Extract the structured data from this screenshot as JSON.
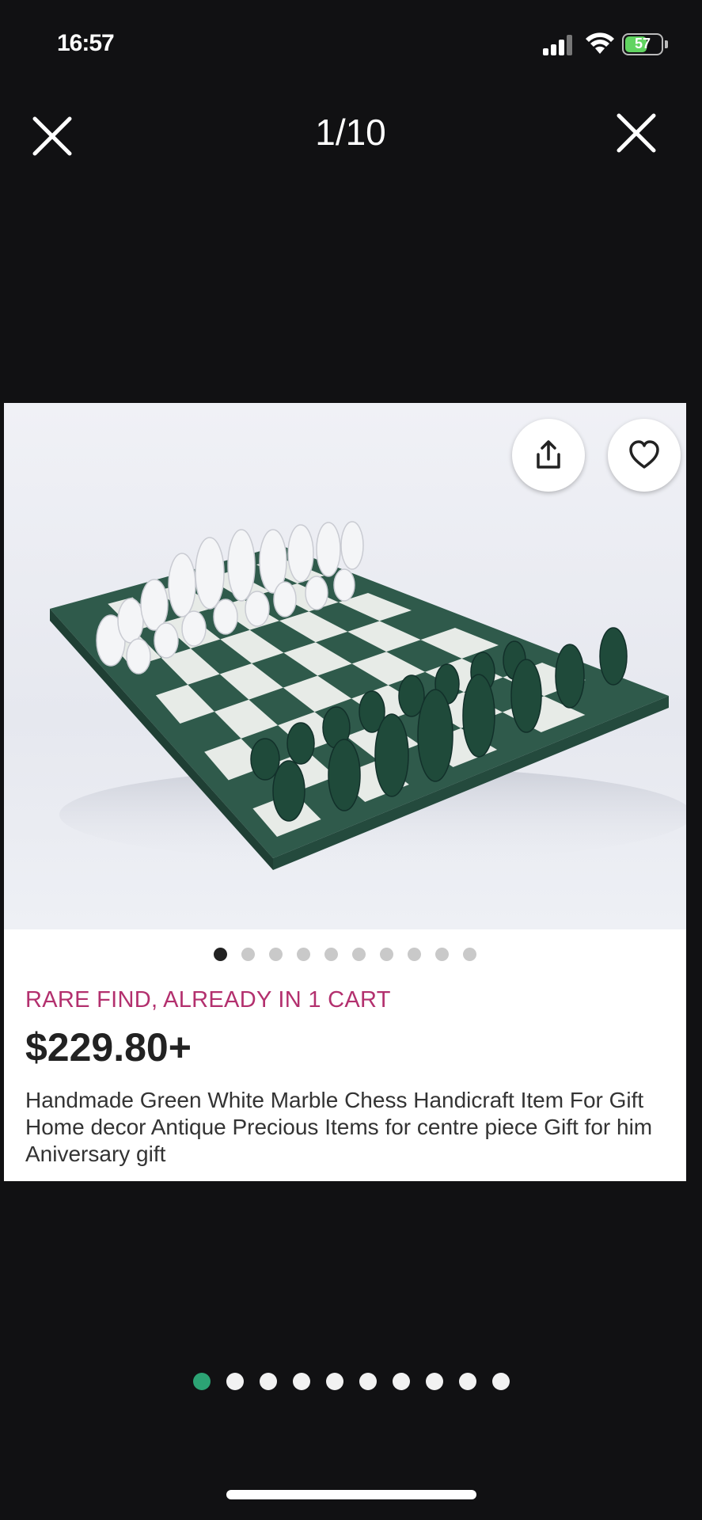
{
  "status_bar": {
    "time": "16:57",
    "battery": "57"
  },
  "header": {
    "counter": "1/10"
  },
  "listing": {
    "badge": "RARE FIND, ALREADY IN 1 CART",
    "price": "$229.80+",
    "title": "Handmade Green White Marble Chess Handicraft Item For Gift Home decor Antique Precious Items for centre piece Gift for him Aniversary gift"
  },
  "icons": {
    "close": "close-icon",
    "share": "share-icon",
    "favorite": "heart-icon"
  },
  "image_carousel": {
    "total": 10,
    "active_index": 0
  },
  "page_carousel": {
    "total": 10,
    "active_index": 0
  },
  "colors": {
    "background": "#111113",
    "badge": "#b3306e",
    "active_page_dot": "#2ca374",
    "board_dark": "#2f5a4b",
    "board_light": "#e7ebe7"
  }
}
